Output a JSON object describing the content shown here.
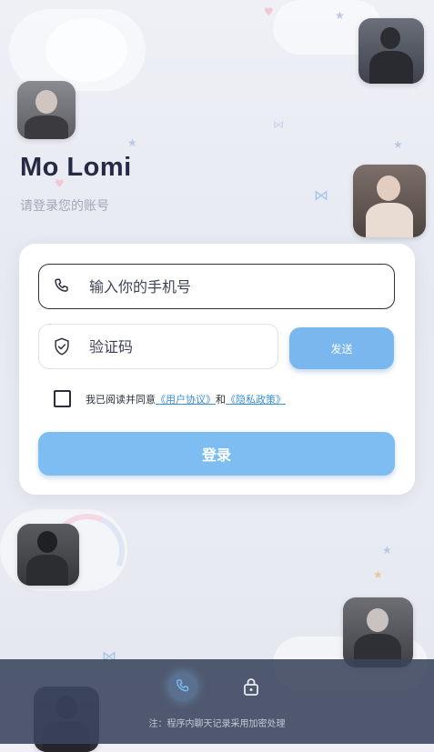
{
  "brand": {
    "title": "Mo Lomi",
    "subtitle": "请登录您的账号"
  },
  "form": {
    "phone_placeholder": "输入你的手机号",
    "code_placeholder": "验证码",
    "send_label": "发送",
    "agree_prefix": "我已阅读并同意",
    "user_agreement": "《用户协议》",
    "and_text": "和",
    "privacy_policy": "《隐私政策》",
    "login_label": "登录",
    "agreed": false
  },
  "footer": {
    "note": "注：程序内聊天记录采用加密处理",
    "tabs": [
      {
        "icon": "phone-icon",
        "active": true
      },
      {
        "icon": "lock-icon",
        "active": false
      }
    ]
  },
  "colors": {
    "accent": "#7ab7ee",
    "link": "#3a8fd6",
    "title": "#262a45",
    "bottom_bar": "#3a445c"
  }
}
